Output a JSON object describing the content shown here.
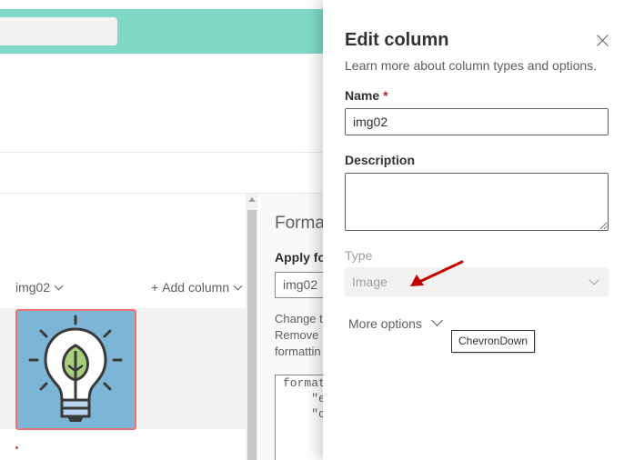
{
  "list": {
    "columns": [
      {
        "label": "img02"
      },
      {
        "label": "Add column",
        "prefix": "+"
      }
    ],
    "rows": [
      {
        "image_icon": "lightbulb-leaf-icon"
      }
    ]
  },
  "format_pane": {
    "title": "Forma",
    "apply_label": "Apply fo",
    "selected_field": "img02",
    "help_text": "Change t\nRemove\nformattin",
    "code": "formatt\n    \"e\n    \"c"
  },
  "edit_panel": {
    "title": "Edit column",
    "learn_more": "Learn more about column types and options.",
    "name_label": "Name",
    "required_marker": "*",
    "name_value": "img02",
    "description_label": "Description",
    "description_value": "",
    "type_label": "Type",
    "type_value": "Image",
    "more_options": "More options",
    "tooltip": "ChevronDown"
  },
  "colors": {
    "header_bar": "#80d9c7",
    "required": "#a4262c",
    "annotation_arrow": "#c00000",
    "image_border": "#e97272",
    "image_background": "#7cb5d5"
  }
}
